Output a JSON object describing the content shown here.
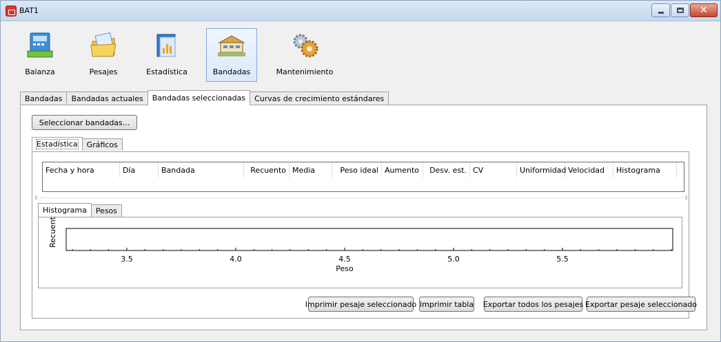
{
  "window": {
    "title": "BAT1"
  },
  "toolbar": {
    "items": [
      {
        "label": "Balanza",
        "icon": "scale-icon"
      },
      {
        "label": "Pesajes",
        "icon": "folder-icon"
      },
      {
        "label": "Estadística",
        "icon": "statistics-icon"
      },
      {
        "label": "Bandadas",
        "icon": "poultry-house-icon"
      },
      {
        "label": "Mantenimiento",
        "icon": "gears-icon"
      }
    ],
    "active": "Bandadas"
  },
  "main_tabs": [
    "Bandadas",
    "Bandadas actuales",
    "Bandadas seleccionadas",
    "Curvas de crecimiento estándares"
  ],
  "select_button": "Seleccionar bandadas...",
  "sub_tabs": [
    "Estadística",
    "Gráficos"
  ],
  "table": {
    "columns": [
      "Fecha y hora",
      "Día",
      "Bandada",
      "Recuento",
      "Media",
      "Peso ideal",
      "Aumento",
      "Desv. est.",
      "CV",
      "Uniformidad",
      "Velocidad",
      "Histograma"
    ],
    "rows": []
  },
  "chart_tabs": [
    "Histograma",
    "Pesos"
  ],
  "chart_data": {
    "type": "bar",
    "ylabel": "Recuento",
    "xlabel": "Peso",
    "xticks": [
      "3.5",
      "4.0",
      "4.5",
      "5.0",
      "5.5"
    ],
    "values": []
  },
  "buttons": {
    "print_selected": "Imprimir pesaje seleccionado",
    "print_table": "Imprimir tabla",
    "export_all": "Exportar todos los pesajes",
    "export_selected": "Exportar pesaje seleccionado"
  }
}
